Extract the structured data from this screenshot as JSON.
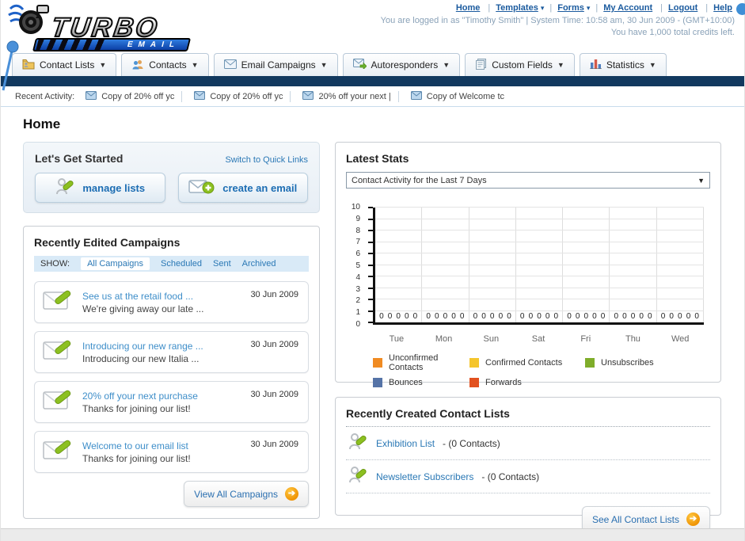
{
  "header": {
    "logo_line1": "TURBO",
    "logo_line2": "EMAIL",
    "nav_links": [
      {
        "label": "Home",
        "dropdown": false
      },
      {
        "label": "Templates",
        "dropdown": true
      },
      {
        "label": "Forms",
        "dropdown": true
      },
      {
        "label": "My Account",
        "dropdown": false
      },
      {
        "label": "Logout",
        "dropdown": false
      },
      {
        "label": "Help",
        "dropdown": false
      }
    ],
    "login_line1": "You are logged in as \"Timothy Smith\" | System Time: 10:58 am, 30 Jun 2009 - (GMT+10:00)",
    "login_line2": "You have 1,000 total credits left."
  },
  "tabs": [
    {
      "label": "Contact Lists",
      "icon": "contact-lists-icon"
    },
    {
      "label": "Contacts",
      "icon": "contacts-icon"
    },
    {
      "label": "Email Campaigns",
      "icon": "email-campaigns-icon"
    },
    {
      "label": "Autoresponders",
      "icon": "autoresponders-icon"
    },
    {
      "label": "Custom Fields",
      "icon": "custom-fields-icon"
    },
    {
      "label": "Statistics",
      "icon": "statistics-icon"
    }
  ],
  "recent_activity": {
    "label": "Recent Activity:",
    "items": [
      "Copy of 20% off yc",
      "Copy of 20% off yc",
      "20% off your next |",
      "Copy of Welcome tc"
    ]
  },
  "page_title": "Home",
  "get_started": {
    "title": "Let's Get Started",
    "switch_link": "Switch to Quick Links",
    "manage_lists_label": "manage lists",
    "create_email_label": "create an email"
  },
  "campaigns": {
    "title": "Recently Edited Campaigns",
    "show_label": "SHOW:",
    "filters": [
      "All Campaigns",
      "Scheduled",
      "Sent",
      "Archived"
    ],
    "active_filter": "All Campaigns",
    "items": [
      {
        "title": "See us at the retail food ...",
        "subtitle": "We're giving away our late ...",
        "date": "30 Jun 2009"
      },
      {
        "title": "Introducing our new range ...",
        "subtitle": "Introducing our new Italia ...",
        "date": "30 Jun 2009"
      },
      {
        "title": "20% off your next purchase",
        "subtitle": "Thanks for joining our list!",
        "date": "30 Jun 2009"
      },
      {
        "title": "Welcome to our email list",
        "subtitle": "Thanks for joining our list!",
        "date": "30 Jun 2009"
      }
    ],
    "view_all_label": "View All Campaigns"
  },
  "latest_stats": {
    "title": "Latest Stats",
    "selected_option": "Contact Activity for the Last 7 Days"
  },
  "chart_data": {
    "type": "bar",
    "title": "Contact Activity for the Last 7 Days",
    "categories": [
      "Tue",
      "Mon",
      "Sun",
      "Sat",
      "Fri",
      "Thu",
      "Wed"
    ],
    "series": [
      {
        "name": "Unconfirmed Contacts",
        "color": "#f08b22",
        "values": [
          0,
          0,
          0,
          0,
          0,
          0,
          0
        ]
      },
      {
        "name": "Confirmed Contacts",
        "color": "#f5c52c",
        "values": [
          0,
          0,
          0,
          0,
          0,
          0,
          0
        ]
      },
      {
        "name": "Unsubscribes",
        "color": "#7fad2a",
        "values": [
          0,
          0,
          0,
          0,
          0,
          0,
          0
        ]
      },
      {
        "name": "Bounces",
        "color": "#5573a7",
        "values": [
          0,
          0,
          0,
          0,
          0,
          0,
          0
        ]
      },
      {
        "name": "Forwards",
        "color": "#e2511f",
        "values": [
          0,
          0,
          0,
          0,
          0,
          0,
          0
        ]
      }
    ],
    "ylim": [
      0,
      10
    ],
    "yticks": [
      0,
      1,
      2,
      3,
      4,
      5,
      6,
      7,
      8,
      9,
      10
    ],
    "grid": true,
    "legend_position": "bottom"
  },
  "contact_lists": {
    "title": "Recently Created Contact Lists",
    "items": [
      {
        "name": "Exhibition List",
        "detail": "- (0 Contacts)"
      },
      {
        "name": "Newsletter Subscribers",
        "detail": "- (0 Contacts)"
      }
    ],
    "see_all_label": "See All Contact Lists"
  }
}
